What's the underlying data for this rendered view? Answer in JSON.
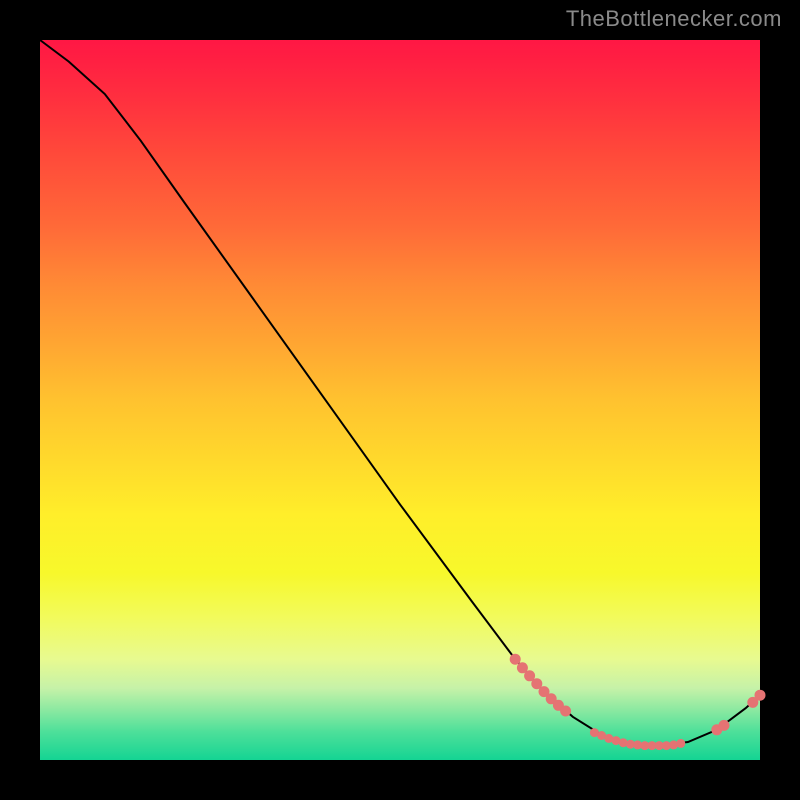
{
  "source_label": "TheBottlenecker.com",
  "chart_data": {
    "type": "line",
    "title": "",
    "xlabel": "",
    "ylabel": "",
    "xlim": [
      0,
      100
    ],
    "ylim": [
      0,
      100
    ],
    "curve": [
      {
        "x": 0,
        "y": 100
      },
      {
        "x": 4,
        "y": 97
      },
      {
        "x": 9,
        "y": 92.5
      },
      {
        "x": 14,
        "y": 86
      },
      {
        "x": 20,
        "y": 77.5
      },
      {
        "x": 30,
        "y": 63.5
      },
      {
        "x": 40,
        "y": 49.5
      },
      {
        "x": 50,
        "y": 35.5
      },
      {
        "x": 60,
        "y": 22
      },
      {
        "x": 66,
        "y": 14
      },
      {
        "x": 70,
        "y": 9.5
      },
      {
        "x": 74,
        "y": 6
      },
      {
        "x": 78,
        "y": 3.5
      },
      {
        "x": 82,
        "y": 2.2
      },
      {
        "x": 86,
        "y": 2.0
      },
      {
        "x": 90,
        "y": 2.5
      },
      {
        "x": 94,
        "y": 4.2
      },
      {
        "x": 98,
        "y": 7.2
      },
      {
        "x": 100,
        "y": 9.0
      }
    ],
    "markers_upper": [
      {
        "x": 66,
        "y": 14
      },
      {
        "x": 67,
        "y": 12.8
      },
      {
        "x": 68,
        "y": 11.7
      },
      {
        "x": 69,
        "y": 10.6
      },
      {
        "x": 70,
        "y": 9.5
      },
      {
        "x": 71,
        "y": 8.5
      },
      {
        "x": 72,
        "y": 7.6
      },
      {
        "x": 73,
        "y": 6.8
      }
    ],
    "markers_bottom": [
      {
        "x": 77,
        "y": 3.8
      },
      {
        "x": 78,
        "y": 3.4
      },
      {
        "x": 79,
        "y": 3.0
      },
      {
        "x": 80,
        "y": 2.7
      },
      {
        "x": 81,
        "y": 2.4
      },
      {
        "x": 82,
        "y": 2.2
      },
      {
        "x": 83,
        "y": 2.1
      },
      {
        "x": 84,
        "y": 2.0
      },
      {
        "x": 85,
        "y": 2.0
      },
      {
        "x": 86,
        "y": 2.0
      },
      {
        "x": 87,
        "y": 2.0
      },
      {
        "x": 88,
        "y": 2.1
      },
      {
        "x": 89,
        "y": 2.3
      }
    ],
    "markers_right": [
      {
        "x": 94,
        "y": 4.2
      },
      {
        "x": 95,
        "y": 4.8
      },
      {
        "x": 99,
        "y": 8.0
      },
      {
        "x": 100,
        "y": 9.0
      }
    ]
  },
  "colors": {
    "background": "#000000",
    "curve": "#000000",
    "marker": "#e57373",
    "label": "#8a8a8a"
  }
}
